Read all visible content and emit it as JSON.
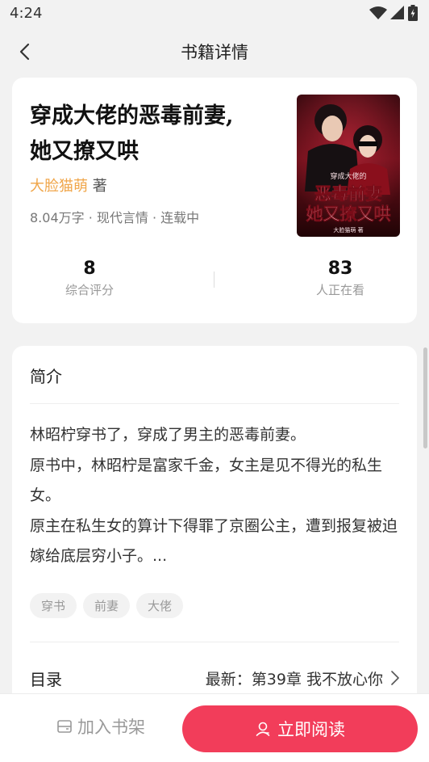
{
  "status_bar": {
    "time": "4:24"
  },
  "nav": {
    "title": "书籍详情"
  },
  "book": {
    "title_line1": "穿成大佬的恶毒前妻,",
    "title_line2": "她又撩又哄",
    "author": "大脸猫萌",
    "author_suffix": "著",
    "meta": "8.04万字 · 现代言情 · 连载中",
    "cover": {
      "subtitle": "穿成大佬的",
      "title_line1": "恶毒前妻",
      "title_line2": "她又撩又哄",
      "author": "大脸猫萌 著"
    },
    "stats": {
      "score_value": "8",
      "score_label": "综合评分",
      "reading_value": "83",
      "reading_label": "人正在看"
    }
  },
  "intro": {
    "heading": "简介",
    "paragraphs": [
      "林昭柠穿书了，穿成了男主的恶毒前妻。",
      "原书中，林昭柠是富家千金，女主是见不得光的私生女。",
      "原主在私生女的算计下得罪了京圈公主，遭到报复被迫嫁给底层穷小子。..."
    ],
    "tags": [
      "穿书",
      "前妻",
      "大佬"
    ]
  },
  "toc": {
    "label": "目录",
    "latest": "最新：第39章 我不放心你"
  },
  "bottom": {
    "shelf_label": "加入书架",
    "read_label": "立即阅读"
  },
  "colors": {
    "accent": "#f23d5a",
    "author": "#f0a64a",
    "background": "#f2f2f2"
  },
  "icons": [
    "wifi-icon",
    "signal-icon",
    "battery-icon",
    "back-arrow-icon",
    "chevron-right-icon",
    "bookshelf-icon",
    "reader-icon"
  ]
}
